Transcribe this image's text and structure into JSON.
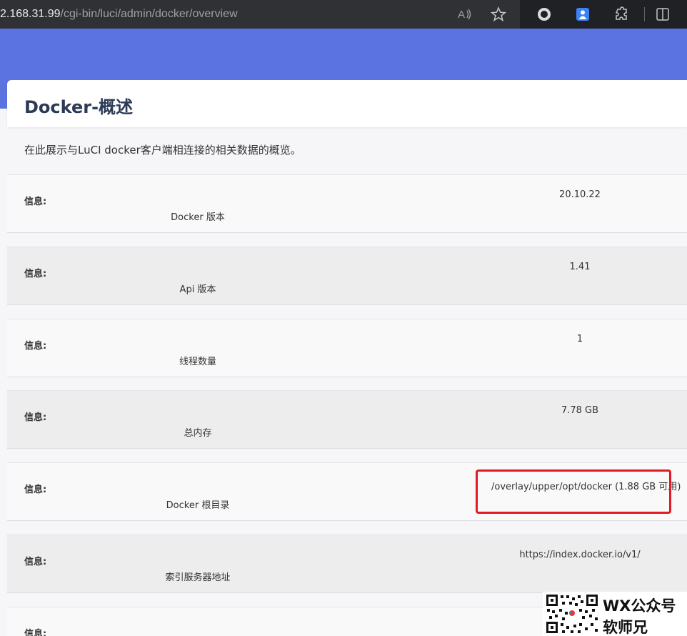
{
  "browser": {
    "url_host": "2.168.31.99",
    "url_path": "/cgi-bin/luci/admin/docker/overview",
    "icons": [
      "read-aloud-icon",
      "favorite-star-icon",
      "record-icon",
      "profile-icon",
      "extensions-icon",
      "split-screen-icon"
    ]
  },
  "page": {
    "title": "Docker-概述",
    "description": "在此展示与LuCI docker客户端相连接的相关数据的概览。"
  },
  "rows": [
    {
      "key": "信息:",
      "name": "Docker 版本",
      "value": "20.10.22"
    },
    {
      "key": "信息:",
      "name": "Api 版本",
      "value": "1.41"
    },
    {
      "key": "信息:",
      "name": "线程数量",
      "value": "1"
    },
    {
      "key": "信息:",
      "name": "总内存",
      "value": "7.78 GB"
    },
    {
      "key": "信息:",
      "name": "Docker 根目录",
      "value": "/overlay/upper/opt/docker (1.88 GB 可用)"
    },
    {
      "key": "信息:",
      "name": "索引服务器地址",
      "value": "https://index.docker.io/v1/"
    },
    {
      "key": "信息:",
      "name": "",
      "value": ""
    }
  ],
  "watermark": {
    "line1": "WX公众号",
    "line2": "软师兄"
  },
  "colors": {
    "header": "#5a73e0",
    "highlight": "#e01b24"
  }
}
